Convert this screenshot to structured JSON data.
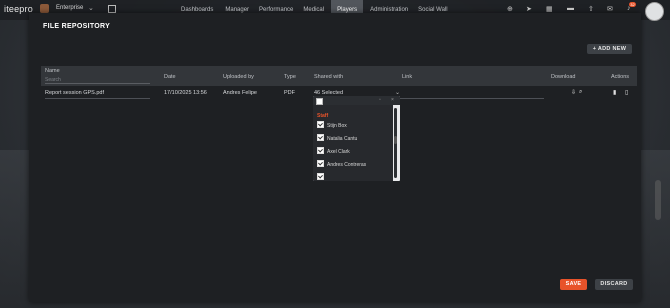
{
  "brand": {
    "logo": "iteepro",
    "org_name": "Enterprise"
  },
  "nav": {
    "items": [
      "Dashboards",
      "Manager",
      "Performance",
      "Medical",
      "Players",
      "Administration",
      "Social Wall"
    ],
    "active": "Players"
  },
  "notifications": {
    "count": "32"
  },
  "page": {
    "title": "FILE REPOSITORY",
    "add_new_label": "+ ADD NEW"
  },
  "table": {
    "columns": {
      "name": "Name",
      "date": "Date",
      "uploaded_by": "Uploaded by",
      "type": "Type",
      "shared_with": "Shared with",
      "link": "Link",
      "download": "Download",
      "actions": "Actions"
    },
    "search_placeholder": "Search",
    "rows": [
      {
        "name": "Report session GPS.pdf",
        "date": "17/10/2025 13:56",
        "uploaded_by": "Andres Felipe",
        "type": "PDF",
        "shared_with": "46 Selected"
      }
    ]
  },
  "dropdown": {
    "group": "Staff",
    "items": [
      "Stijn Box",
      "Natalia Cantu",
      "Axel Clark",
      "Andres Contreras"
    ]
  },
  "footer": {
    "save_label": "SAVE",
    "discard_label": "DISCARD"
  },
  "colors": {
    "accent": "#e8532a",
    "panel": "#1e2023"
  }
}
